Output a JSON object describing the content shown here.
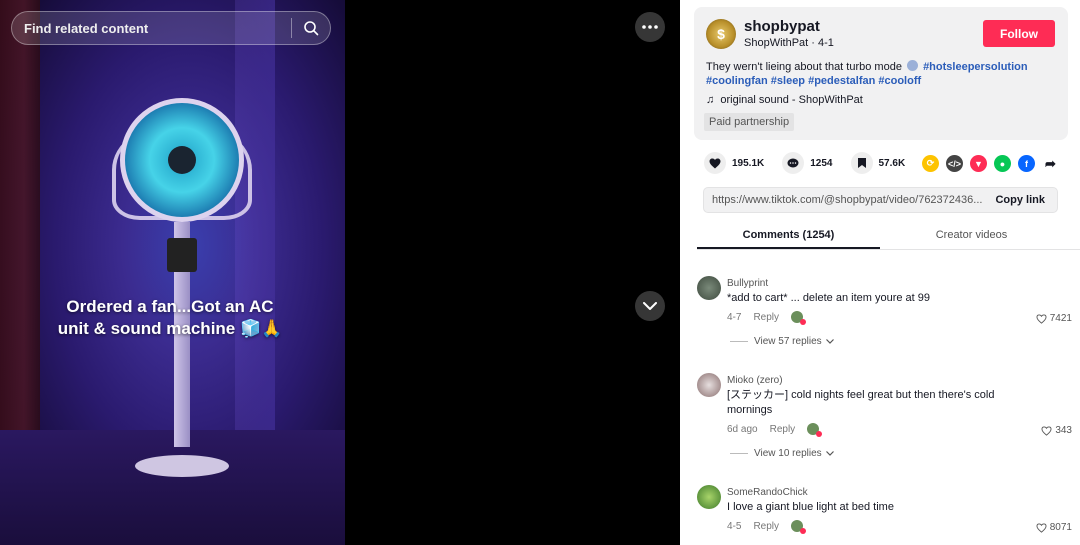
{
  "video": {
    "search_placeholder": "Find related content",
    "caption_line1": "Ordered a fan...Got an AC",
    "caption_line2": "unit & sound machine 🧊🙏"
  },
  "creator": {
    "username": "shopbypat",
    "display_sub": "ShopWithPat · 4-1",
    "follow_label": "Follow",
    "description_text": "They wern't lieing about that turbo mode",
    "hashtags": "#hotsleepersolution #coolingfan #sleep #pedestalfan #cooloff",
    "sound": "original sound - ShopWithPat",
    "paid_tag": "Paid partnership"
  },
  "stats": {
    "likes": "195.1K",
    "comments": "1254",
    "saves": "57.6K"
  },
  "share": {
    "link": "https://www.tiktok.com/@shopbypat/video/762372436...",
    "copy_label": "Copy link"
  },
  "tabs": {
    "comments": "Comments (1254)",
    "creator_videos": "Creator videos"
  },
  "comments": [
    {
      "user": "Bullyprint",
      "text": "*add to cart* ... delete an item youre at 99",
      "date": "4-7",
      "reply": "Reply",
      "likes": "7421",
      "view_replies": "View 57 replies"
    },
    {
      "user": "Mioko (zero)",
      "text": "[ステッカー] cold nights feel great but then there's cold mornings",
      "date": "6d ago",
      "reply": "Reply",
      "likes": "343",
      "view_replies": "View 10 replies"
    },
    {
      "user": "SomeRandoChick",
      "text": "I love a giant blue light at bed time",
      "date": "4-5",
      "reply": "Reply",
      "likes": "8071"
    }
  ],
  "colors": {
    "accent": "#fe2c55",
    "hashtag": "#2b5db9"
  }
}
